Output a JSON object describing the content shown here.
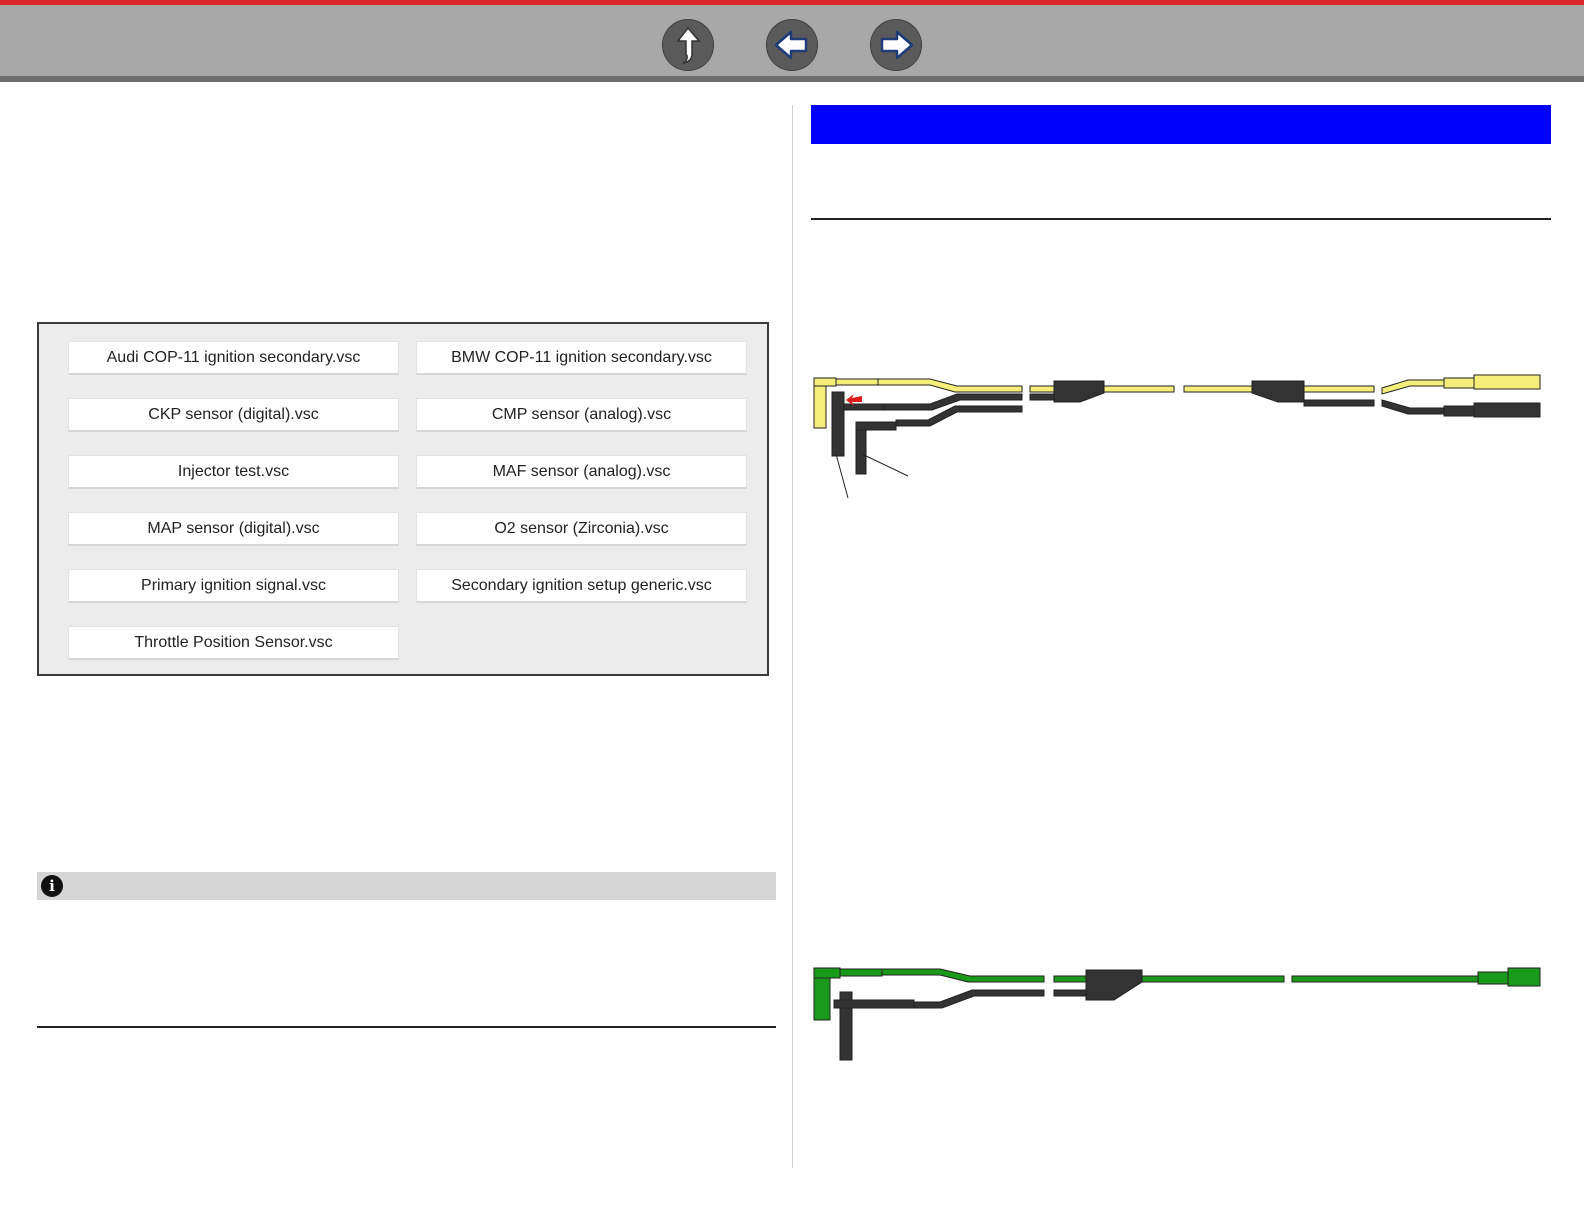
{
  "nav": {
    "buttons": [
      {
        "name": "up-arrow-icon"
      },
      {
        "name": "back-arrow-icon"
      },
      {
        "name": "forward-arrow-icon"
      }
    ]
  },
  "colors": {
    "top_accent": "#d9262b",
    "nav_bar": "#a8a8a8",
    "header_blue": "#0000ff",
    "lead_yellow": "#f5ef7a",
    "lead_green": "#1a9a1a",
    "lead_black": "#333333",
    "arrow_red": "#e01b1b"
  },
  "file_panel": {
    "files": [
      "Audi COP-11 ignition secondary.vsc",
      "BMW COP-11 ignition secondary.vsc",
      "CKP sensor (digital).vsc",
      "CMP sensor (analog).vsc",
      "Injector test.vsc",
      "MAF sensor (analog).vsc",
      "MAP sensor (digital).vsc",
      "O2 sensor (Zirconia).vsc",
      "Primary ignition signal.vsc",
      "Secondary ignition setup generic.vsc",
      "Throttle Position Sensor.vsc"
    ]
  },
  "note": {
    "icon": "info-icon"
  },
  "figures": {
    "yellow_lead": {
      "icon": "yellow-test-lead-illustration"
    },
    "green_lead": {
      "icon": "green-test-lead-illustration"
    }
  }
}
